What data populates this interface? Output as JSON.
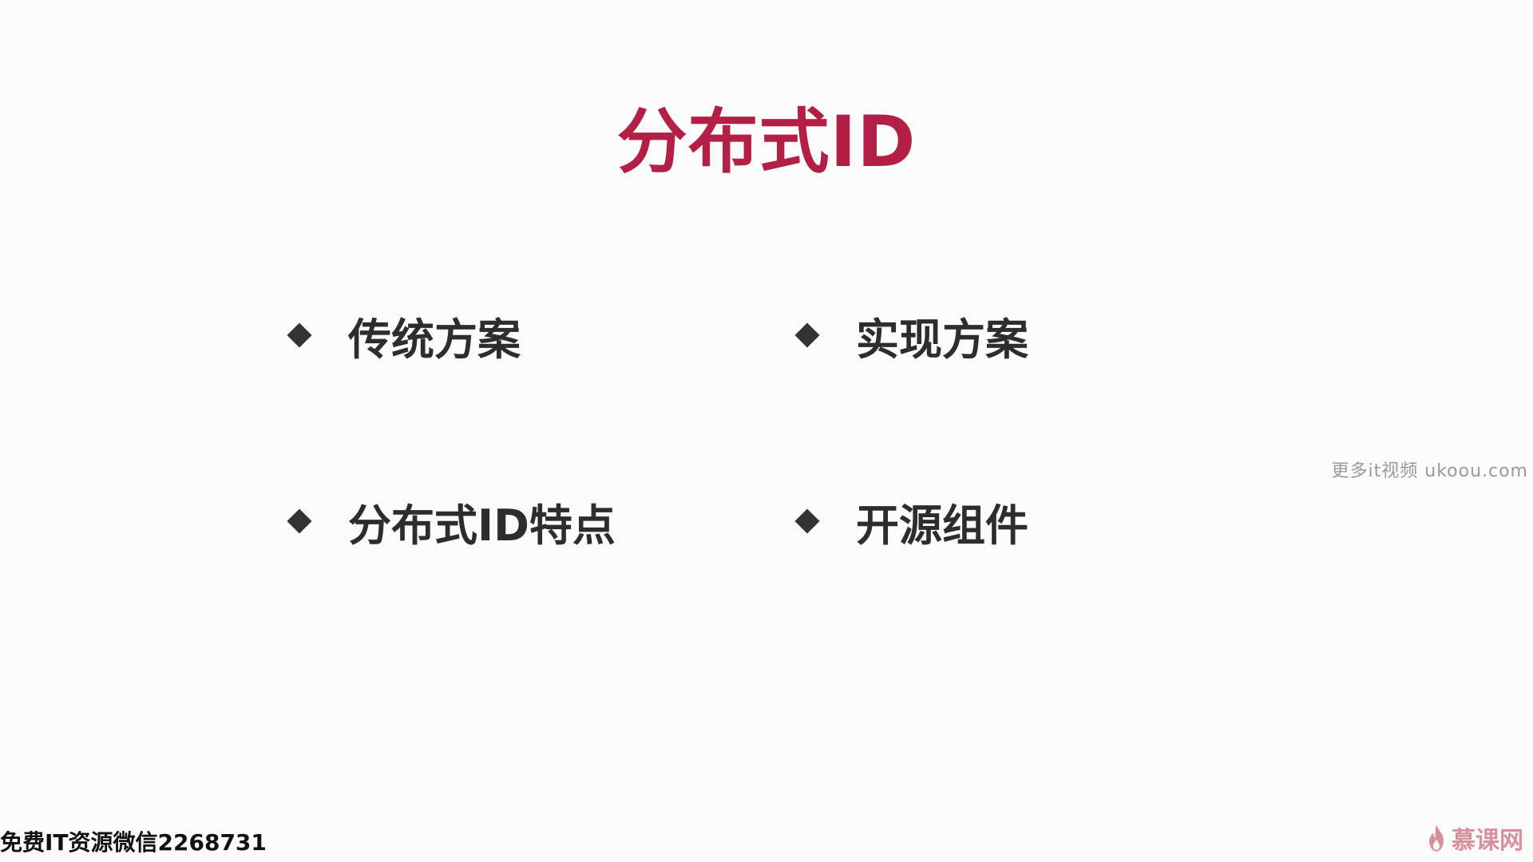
{
  "slide": {
    "title": "分布式ID",
    "bullets": [
      {
        "label": "传统方案"
      },
      {
        "label": "实现方案"
      },
      {
        "label": "分布式ID特点"
      },
      {
        "label": "开源组件"
      }
    ]
  },
  "overlays": {
    "site_watermark": "更多it视频 ukoou.com",
    "promo_text": "免费IT资源微信2268731",
    "brand_name": "慕课网",
    "brand_icon": "flame-logo-icon"
  },
  "colors": {
    "title": "#b31f45",
    "bullet_text": "#2d2d2d",
    "background": "#fbfbfb"
  }
}
